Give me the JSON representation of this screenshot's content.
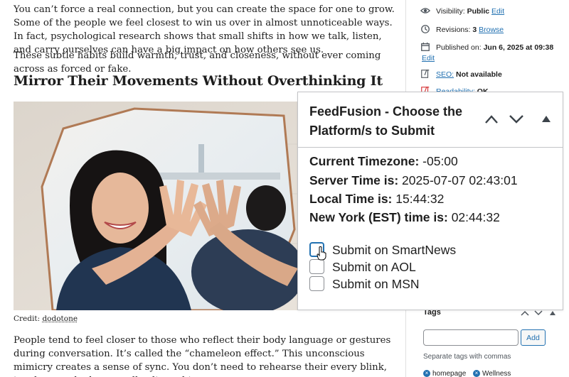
{
  "article": {
    "paragraph1": "You can’t force a real connection, but you can create the space for one to grow. Some of the people we feel closest to win us over in almost unnoticeable ways. In fact, psychological research shows that small shifts in how we talk, listen, and carry ourselves can have a big impact on how others see us.",
    "paragraph2": "These subtle habits build warmth, trust, and closeness, without ever coming across as forced or fake.",
    "heading": "Mirror Their Movements Without Overthinking It",
    "image_alt": "Woman smiling and mirroring her hands against a mirror",
    "caption_prefix": "Credit: ",
    "caption_link": "dodotone",
    "paragraph3": "People tend to feel closer to those who reflect their body language or gestures during conversation. It’s called the “chameleon effect.” This unconscious mimicry creates a sense of sync. You don’t need to rehearse their every blink, just let your body naturally align a bit."
  },
  "sidebar": {
    "visibility": {
      "label": "Visibility:",
      "value": "Public",
      "link": "Edit",
      "icon": "eye-icon"
    },
    "revisions": {
      "label": "Revisions:",
      "value": "3",
      "link": "Browse",
      "icon": "history-icon"
    },
    "published": {
      "label": "Published on:",
      "value": "Jun 6, 2025 at 09:38",
      "link": "Edit",
      "icon": "calendar-icon"
    },
    "seo": {
      "label": "SEO:",
      "value": "Not available",
      "icon": "yoast-icon"
    },
    "readability": {
      "label": "Readability:",
      "value": "OK",
      "icon": "readability-icon"
    },
    "tags": {
      "title": "Tags",
      "input_value": "",
      "add_label": "Add",
      "help": "Separate tags with commas",
      "chips": [
        "homepage",
        "Wellness"
      ]
    }
  },
  "feedfusion": {
    "title": "FeedFusion - Choose the Platform/s to Submit",
    "timezone_label": "Current Timezone:",
    "timezone_value": "-05:00",
    "server_label": "Server Time is:",
    "server_value": "2025-07-07 02:43:01",
    "local_label": "Local Time is:",
    "local_value": "15:44:32",
    "ny_label": "New York (EST) time is:",
    "ny_value": "02:44:32",
    "options": [
      {
        "label": "Submit on SmartNews",
        "checked": false
      },
      {
        "label": "Submit on AOL",
        "checked": false
      },
      {
        "label": "Submit on MSN",
        "checked": false
      }
    ]
  },
  "colors": {
    "link": "#2271b1",
    "border": "#c3c4c7",
    "text": "#1e1e1e"
  }
}
